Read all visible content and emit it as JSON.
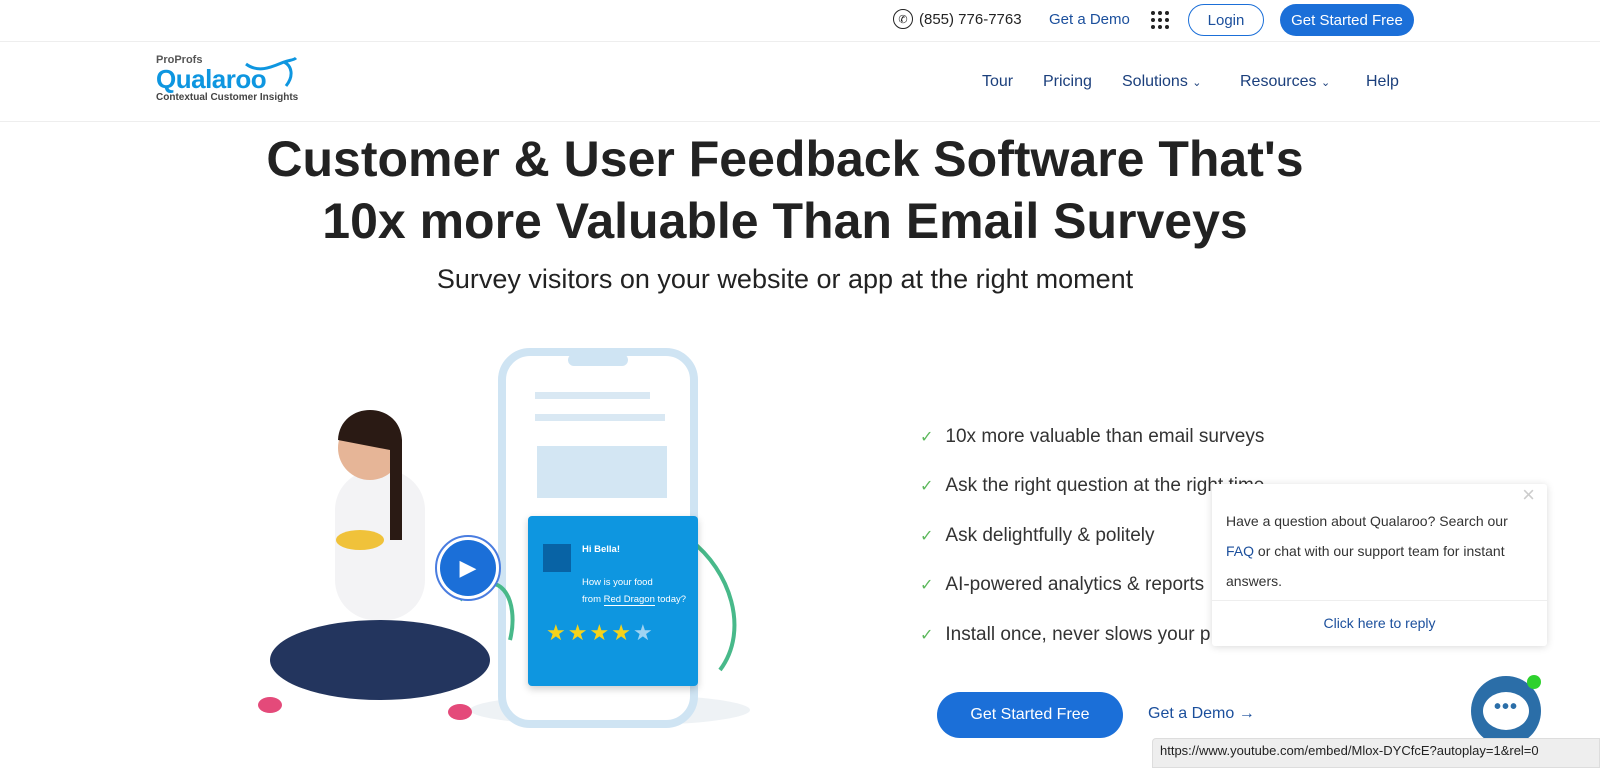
{
  "topbar": {
    "phone": "(855) 776-7763",
    "get_demo": "Get a Demo",
    "login": "Login",
    "get_started": "Get Started Free"
  },
  "logo": {
    "proprofs": "ProProfs",
    "brand": "Qualaroo",
    "tagline": "Contextual Customer Insights"
  },
  "nav": {
    "items": [
      {
        "label": "Tour"
      },
      {
        "label": "Pricing"
      },
      {
        "label": "Solutions",
        "dropdown": true
      },
      {
        "label": "Resources",
        "dropdown": true
      },
      {
        "label": "Help"
      }
    ]
  },
  "hero": {
    "title_line1": "Customer & User Feedback Software That's",
    "title_line2": "10x more Valuable Than Email Surveys",
    "subtitle": "Survey visitors on your website or app at the right moment"
  },
  "survey_card": {
    "greeting": "Hi Bella!",
    "question_line1": "How is your food",
    "question_line2_pre": "from ",
    "question_link": "Red Dragon",
    "question_line2_post": " today?",
    "rating": 4,
    "max_rating": 5
  },
  "bullets": [
    "10x more valuable than email surveys",
    "Ask the right question at the right time",
    "Ask delightfully & politely",
    "AI-powered analytics & reports",
    "Install once, never slows your p"
  ],
  "cta": {
    "get_started": "Get Started Free",
    "get_demo": "Get a Demo",
    "arrow": "→"
  },
  "chat_popup": {
    "text_pre": "Have a question about Qualaroo? Search our ",
    "faq": "FAQ",
    "text_post": " or chat with our support team for instant answers.",
    "reply": "Click here to reply",
    "close": "×"
  },
  "chat_widget": {
    "icon": "chat-bubble-icon",
    "dots": "•••"
  },
  "status_bar": {
    "url": "https://www.youtube.com/embed/Mlox-DYCfcE?autoplay=1&rel=0"
  },
  "colors": {
    "brand": "#0e96e0",
    "button": "#1b6fd8",
    "nav_text": "#1b3f7c",
    "card": "#0e96e0",
    "star": "#f5d31c"
  }
}
